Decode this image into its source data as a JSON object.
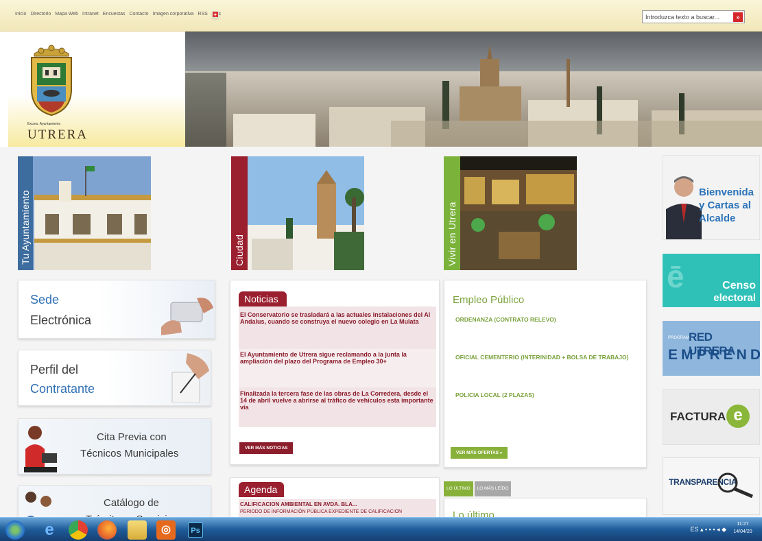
{
  "topnav": {
    "items": [
      "Inicio",
      "Directorio",
      "Mapa Web",
      "Intranet",
      "Encuestas",
      "Contacto",
      "Imagen corporativa",
      "RSS"
    ],
    "flag_label": "Más"
  },
  "search": {
    "placeholder": "Introduzca texto a buscar..."
  },
  "logo": {
    "small": "Excmo. Ayuntamiento",
    "name": "UTRERA"
  },
  "tiles": {
    "ayuntamiento": "Tu Ayuntamiento",
    "ciudad": "Ciudad",
    "vivir": "Vivir en Utrera"
  },
  "services": {
    "sede": {
      "line1": "Sede",
      "line2": "Electrónica"
    },
    "perfil": {
      "line1": "Perfil del",
      "line2": "Contratante"
    },
    "cita": {
      "line1": "Cita Previa con",
      "line2": "Técnicos Municipales"
    },
    "catalogo": {
      "line1": "Catálogo de",
      "line2": "Trámites y Servicios"
    }
  },
  "news": {
    "title": "Noticias",
    "items": [
      "El Conservatorio se trasladará a las actuales instalaciones del Al Andalus, cuando se construya el nuevo colegio en La Mulata",
      "El Ayuntamiento de Utrera sigue reclamando a la junta la ampliación del plazo del Programa de Empleo 30+",
      "Finalizada la tercera fase de las obras de La Corredera, desde el 14 de abril vuelve a abrirse al tráfico de vehículos esta importante vía"
    ],
    "more": "VER MÁS NOTICIAS"
  },
  "agenda": {
    "title": "Agenda",
    "item_title": "CALIFICACION AMBIENTAL EN AVDA. BLA...",
    "item_sub": "PERIODO DE INFORMACIÓN PÚBLICA EXPEDIENTE DE CALIFICACION"
  },
  "empleo": {
    "title": "Empleo Público",
    "items": [
      "ORDENANZA (CONTRATO RELEVO)",
      "OFICIAL CEMENTERIO (INTERINIDAD + BOLSA DE TRABAJO)",
      "POLICIA LOCAL (2 PLAZAS)"
    ],
    "more": "VER MÁS OFERTAS »"
  },
  "tabs": {
    "ultimo": "LO ÚLTIMO",
    "leido": "LO MÁS LEÍDO",
    "heading": "Lo último"
  },
  "side": {
    "alcalde": "Bienvenida y Cartas al Alcalde",
    "censo1": "Censo",
    "censo2": "electoral",
    "emprende1": "RED UTRERA",
    "emprende2": "EMPRENDE",
    "emprende_prefix": "PROGRAMA",
    "factura": "FACTURA",
    "factura_e": "e",
    "transp": "TRANSPARENCIA"
  },
  "taskbar": {
    "lang": "ES",
    "time": "11:27",
    "date": "14/04/20"
  },
  "colors": {
    "maroon": "#9a1f2f",
    "green": "#88b13a",
    "blue": "#1f5c99",
    "teal": "#2fc1b8"
  }
}
